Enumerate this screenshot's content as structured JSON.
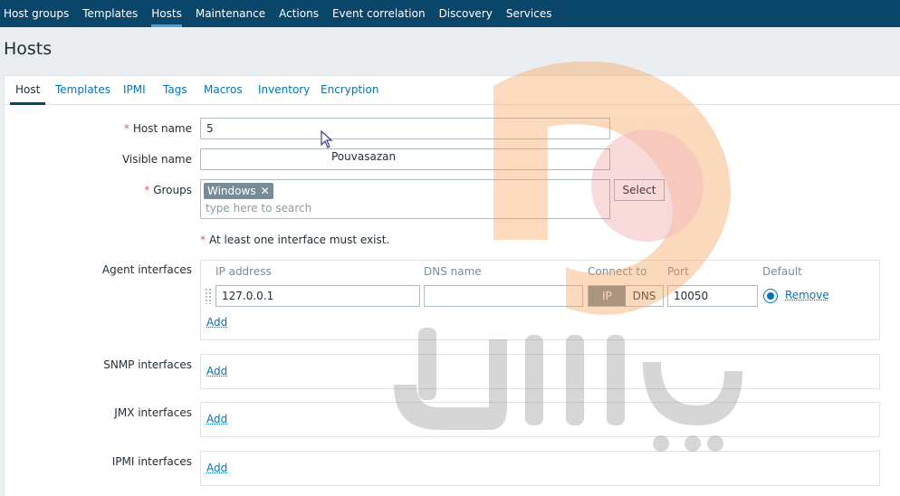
{
  "nav": {
    "items": [
      "Host groups",
      "Templates",
      "Hosts",
      "Maintenance",
      "Actions",
      "Event correlation",
      "Discovery",
      "Services"
    ]
  },
  "page": {
    "title": "Hosts"
  },
  "tabs": [
    "Host",
    "Templates",
    "IPMI",
    "Tags",
    "Macros",
    "Inventory",
    "Encryption"
  ],
  "form": {
    "host_name_label": "Host name",
    "host_name_value": "5",
    "visible_name_label": "Visible name",
    "visible_name_value": "",
    "groups_label": "Groups",
    "group_chip": "Windows",
    "groups_placeholder": "type here to search",
    "select_button": "Select",
    "warning": "At least one interface must exist.",
    "required_mark": "*"
  },
  "agent": {
    "label": "Agent interfaces",
    "headers": {
      "ip": "IP address",
      "dns": "DNS name",
      "connect": "Connect to",
      "port": "Port",
      "default": "Default"
    },
    "ip_value": "127.0.0.1",
    "dns_value": "",
    "connect_ip": "IP",
    "connect_dns": "DNS",
    "port_value": "10050",
    "remove": "Remove",
    "add": "Add"
  },
  "snmp": {
    "label": "SNMP interfaces",
    "add": "Add"
  },
  "jmx": {
    "label": "JMX interfaces",
    "add": "Add"
  },
  "ipmi": {
    "label": "IPMI interfaces",
    "add": "Add"
  },
  "watermark": {
    "text": "Pouvasazan",
    "logo_colors": [
      "#f6a35b",
      "#e45959",
      "#9a9a9a"
    ]
  }
}
